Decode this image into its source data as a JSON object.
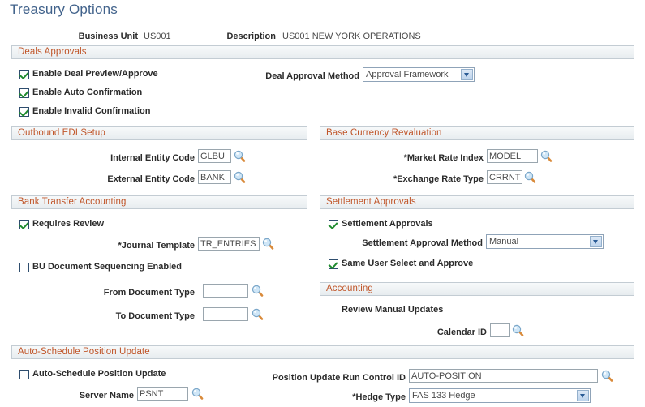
{
  "page": {
    "title": "Treasury Options"
  },
  "header": {
    "business_unit_label": "Business Unit",
    "business_unit_value": "US001",
    "description_label": "Description",
    "description_value": "US001 NEW YORK OPERATIONS"
  },
  "sections": {
    "deals_approvals": {
      "title": "Deals Approvals",
      "checkboxes": [
        {
          "label": "Enable Deal Preview/Approve",
          "checked": true
        },
        {
          "label": "Enable Auto Confirmation",
          "checked": true
        },
        {
          "label": "Enable Invalid Confirmation",
          "checked": true
        }
      ],
      "deal_approval_method_label": "Deal Approval Method",
      "deal_approval_method_value": "Approval Framework"
    },
    "outbound_edi": {
      "title": "Outbound EDI Setup",
      "internal_entity_code_label": "Internal Entity Code",
      "internal_entity_code_value": "GLBU",
      "external_entity_code_label": "External Entity Code",
      "external_entity_code_value": "BANK"
    },
    "base_currency_revaluation": {
      "title": "Base Currency Revaluation",
      "market_rate_index_label": "*Market Rate Index",
      "market_rate_index_value": "MODEL",
      "exchange_rate_type_label": "*Exchange Rate Type",
      "exchange_rate_type_value": "CRRNT"
    },
    "bank_transfer_accounting": {
      "title": "Bank Transfer Accounting",
      "requires_review_label": "Requires Review",
      "requires_review_checked": true,
      "journal_template_label": "*Journal Template",
      "journal_template_value": "TR_ENTRIES",
      "bu_doc_seq_label": "BU Document Sequencing Enabled",
      "bu_doc_seq_checked": false,
      "from_document_type_label": "From Document Type",
      "from_document_type_value": "",
      "to_document_type_label": "To Document Type",
      "to_document_type_value": ""
    },
    "settlement_approvals": {
      "title": "Settlement Approvals",
      "settlement_approvals_label": "Settlement Approvals",
      "settlement_approvals_checked": true,
      "settlement_approval_method_label": "Settlement Approval Method",
      "settlement_approval_method_value": "Manual",
      "same_user_label": "Same User Select and Approve",
      "same_user_checked": true
    },
    "accounting": {
      "title": "Accounting",
      "review_manual_updates_label": "Review Manual Updates",
      "review_manual_updates_checked": false,
      "calendar_id_label": "Calendar ID",
      "calendar_id_value": ""
    },
    "auto_schedule": {
      "title": "Auto-Schedule Position Update",
      "auto_schedule_label": "Auto-Schedule Position Update",
      "auto_schedule_checked": false,
      "server_name_label": "Server Name",
      "server_name_value": "PSNT",
      "run_control_label": "Position Update Run Control ID",
      "run_control_value": "AUTO-POSITION",
      "hedge_type_label": "*Hedge Type",
      "hedge_type_value": "FAS 133 Hedge"
    }
  },
  "icons": {
    "lookup": "magnifier-icon",
    "dropdown": "chevron-down-icon"
  },
  "colors": {
    "title": "#41628b",
    "section_header_text": "#c0562a",
    "check": "#1f8b2e"
  }
}
